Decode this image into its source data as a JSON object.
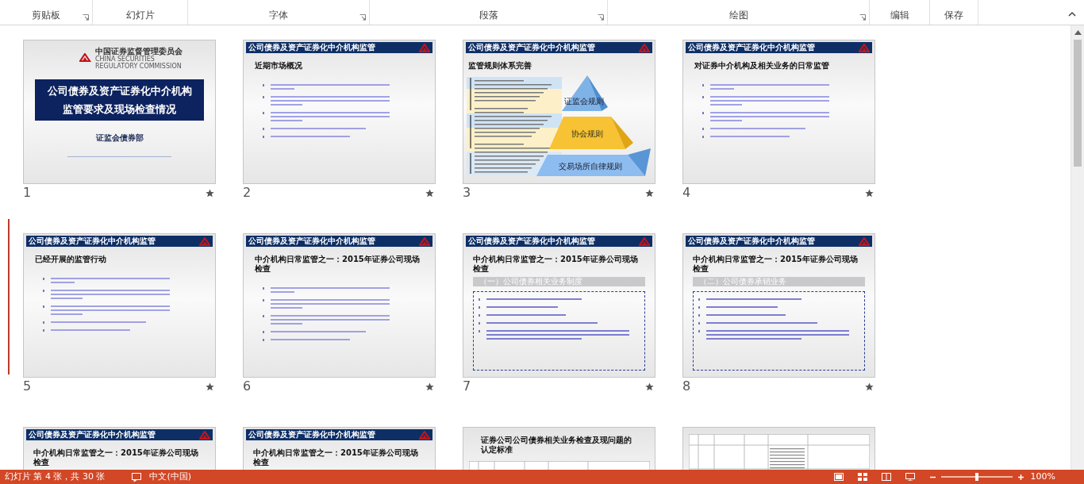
{
  "ribbon": {
    "groups": [
      {
        "label": "剪贴板",
        "launcher": true
      },
      {
        "label": "幻灯片",
        "launcher": false
      },
      {
        "label": "字体",
        "launcher": true
      },
      {
        "label": "段落",
        "launcher": true
      },
      {
        "label": "绘图",
        "launcher": true
      },
      {
        "label": "编辑",
        "launcher": false
      },
      {
        "label": "保存",
        "launcher": false
      }
    ]
  },
  "slides": [
    {
      "number": "1",
      "kind": "title",
      "logo_text": "中国证券监督管理委员会",
      "logo_subtext": "CHINA SECURITIES REGULATORY COMMISSION",
      "title": "公司债券及资产证券化中介机构监管要求及现场检查情况",
      "subtitle": "证监会债券部"
    },
    {
      "number": "2",
      "kind": "bullets",
      "header": "公司债券及资产证券化中介机构监管",
      "heading": "近期市场概况"
    },
    {
      "number": "3",
      "kind": "pyramid",
      "header": "公司债券及资产证券化中介机构监管",
      "heading": "监管规则体系完善",
      "tiers": [
        "证监会规则",
        "协会规则",
        "交易场所自律规则"
      ]
    },
    {
      "number": "4",
      "kind": "bullets",
      "header": "公司债券及资产证券化中介机构监管",
      "heading": "对证券中介机构及相关业务的日常监管"
    },
    {
      "number": "5",
      "kind": "bullets",
      "header": "公司债券及资产证券化中介机构监管",
      "heading": "已经开展的监管行动"
    },
    {
      "number": "6",
      "kind": "bullets",
      "header": "公司债券及资产证券化中介机构监管",
      "heading": "中介机构日常监管之一：2015年证券公司现场检查"
    },
    {
      "number": "7",
      "kind": "boxed",
      "header": "公司债券及资产证券化中介机构监管",
      "heading": "中介机构日常监管之一：2015年证券公司现场检查",
      "section": "（一）公司债券相关业务制度"
    },
    {
      "number": "8",
      "kind": "boxed",
      "header": "公司债券及资产证券化中介机构监管",
      "heading": "中介机构日常监管之一：2015年证券公司现场检查",
      "section": "（二）公司债券承销业务"
    },
    {
      "kind": "boxed",
      "header": "公司债券及资产证券化中介机构监管",
      "heading": "中介机构日常监管之一：2015年证券公司现场检查"
    },
    {
      "kind": "boxed",
      "header": "公司债券及资产证券化中介机构监管",
      "heading": "中介机构日常监管之一：2015年证券公司现场检查"
    },
    {
      "kind": "table",
      "heading": "证券公司公司债券相关业务检查及现问题的认定标准"
    },
    {
      "kind": "table"
    }
  ],
  "status_bar": {
    "slide_info": "幻灯片 第 4 张，共 30 张",
    "language": "中文(中国)",
    "zoom_slider": {
      "level": 0.5
    },
    "zoom": "100%"
  }
}
